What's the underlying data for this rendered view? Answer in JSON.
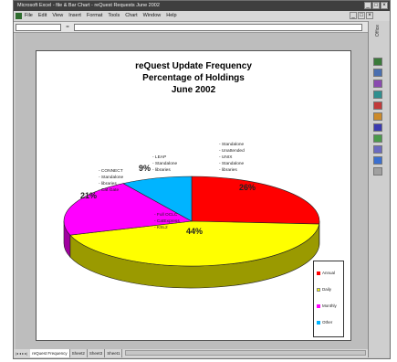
{
  "window": {
    "title": "Microsoft Excel - file & Bar Chart - reQuest Requests June 2002",
    "controls": [
      "_",
      "□",
      "×"
    ],
    "doc_controls": [
      "_",
      "□",
      "×"
    ]
  },
  "menubar": {
    "items": [
      "File",
      "Edit",
      "View",
      "Insert",
      "Format",
      "Tools",
      "Chart",
      "Window",
      "Help"
    ]
  },
  "formula_bar": {
    "fx_label": "="
  },
  "office_bar": {
    "label": "Office",
    "buttons": [
      {
        "name": "office-btn-1",
        "color": "#3a7a3a"
      },
      {
        "name": "office-btn-2",
        "color": "#4a6fb0"
      },
      {
        "name": "office-btn-3",
        "color": "#8a4ab0"
      },
      {
        "name": "office-btn-4",
        "color": "#2f8f8f"
      },
      {
        "name": "office-btn-5",
        "color": "#c23a3a"
      },
      {
        "name": "office-btn-6",
        "color": "#cc8a2a"
      },
      {
        "name": "office-btn-7",
        "color": "#3a3ab0"
      },
      {
        "name": "office-btn-8",
        "color": "#4a9a4a"
      },
      {
        "name": "office-btn-9",
        "color": "#6a6ac0"
      },
      {
        "name": "office-btn-10",
        "color": "#3a6fd0"
      },
      {
        "name": "office-btn-11",
        "color": "#a0a0a0"
      }
    ]
  },
  "tabs": {
    "nav": [
      "|◂",
      "◂",
      "▸",
      "▸|"
    ],
    "items": [
      "reQuest Frequency",
      "Sheet2",
      "Sheet3",
      "Sheet1"
    ],
    "active_index": 0
  },
  "chart_data": {
    "type": "pie",
    "title_lines": [
      "reQuest Update Frequency",
      "Percentage of Holdings",
      "June 2002"
    ],
    "categories": [
      "Annual",
      "Daily",
      "Monthly",
      "Other"
    ],
    "values": [
      26,
      44,
      21,
      9
    ],
    "colors": [
      "#ff0000",
      "#ffff00",
      "#ff00ff",
      "#00b4ff"
    ],
    "side_colors": [
      "#a00000",
      "#9a9a00",
      "#a000a0",
      "#0077a8"
    ],
    "percent_labels": [
      "26%",
      "44%",
      "21%",
      "9%"
    ],
    "slice_notes": [
      [
        "Standalone",
        "Unattended",
        "UNIX",
        "Standalone",
        "libraries"
      ],
      [
        "Full OCLC",
        "CatExpress",
        "KSL2"
      ],
      [
        "CONNECT",
        "Standalone",
        "libraries",
        "Cat Gate"
      ],
      [
        "LEAP",
        "Standalone",
        "libraries"
      ]
    ],
    "legend": {
      "position": "bottom-right",
      "entries": [
        "Annual",
        "Daily",
        "Monthly",
        "Other"
      ]
    },
    "legend_position": "bottom-right"
  }
}
